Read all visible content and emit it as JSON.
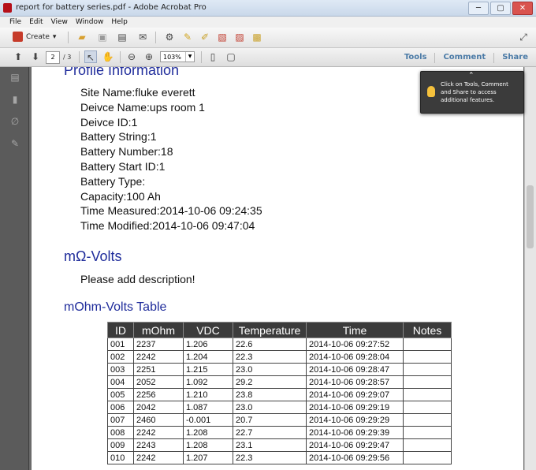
{
  "window": {
    "title": "report for battery series.pdf - Adobe Acrobat Pro",
    "min": "─",
    "max": "▢",
    "close": "✕"
  },
  "menu": [
    "File",
    "Edit",
    "View",
    "Window",
    "Help"
  ],
  "toolbar": {
    "create_label": "Create",
    "page_current": "2",
    "page_total": "/ 3",
    "zoom": "103%",
    "tools_label": "Tools",
    "comment_label": "Comment",
    "share_label": "Share"
  },
  "tooltip": {
    "text": "Click on Tools, Comment and Share to access additional features."
  },
  "document": {
    "profile_heading": "Profile Information",
    "info_lines": [
      "Site Name:fluke everett",
      "Deivce Name:ups room 1",
      "Deivce ID:1",
      "Battery String:1",
      "Battery Number:18",
      "Battery Start ID:1",
      "Battery Type:",
      "Capacity:100 Ah",
      "Time Measured:2014-10-06 09:24:35",
      "Time Modified:2014-10-06 09:47:04"
    ],
    "section_heading": "mΩ-Volts",
    "description": "Please add description!",
    "table_heading": "mOhm-Volts Table",
    "table": {
      "headers": [
        "ID",
        "mOhm",
        "VDC",
        "Temperature",
        "Time",
        "Notes"
      ],
      "rows": [
        [
          "001",
          "2237",
          "1.206",
          "22.6",
          "2014-10-06 09:27:52",
          ""
        ],
        [
          "002",
          "2242",
          "1.204",
          "22.3",
          "2014-10-06 09:28:04",
          ""
        ],
        [
          "003",
          "2251",
          "1.215",
          "23.0",
          "2014-10-06 09:28:47",
          ""
        ],
        [
          "004",
          "2052",
          "1.092",
          "29.2",
          "2014-10-06 09:28:57",
          ""
        ],
        [
          "005",
          "2256",
          "1.210",
          "23.8",
          "2014-10-06 09:29:07",
          ""
        ],
        [
          "006",
          "2042",
          "1.087",
          "23.0",
          "2014-10-06 09:29:19",
          ""
        ],
        [
          "007",
          "2460",
          "-0.001",
          "20.7",
          "2014-10-06 09:29:29",
          ""
        ],
        [
          "008",
          "2242",
          "1.208",
          "22.7",
          "2014-10-06 09:29:39",
          ""
        ],
        [
          "009",
          "2243",
          "1.208",
          "23.1",
          "2014-10-06 09:29:47",
          ""
        ],
        [
          "010",
          "2242",
          "1.207",
          "22.3",
          "2014-10-06 09:29:56",
          ""
        ]
      ]
    }
  }
}
